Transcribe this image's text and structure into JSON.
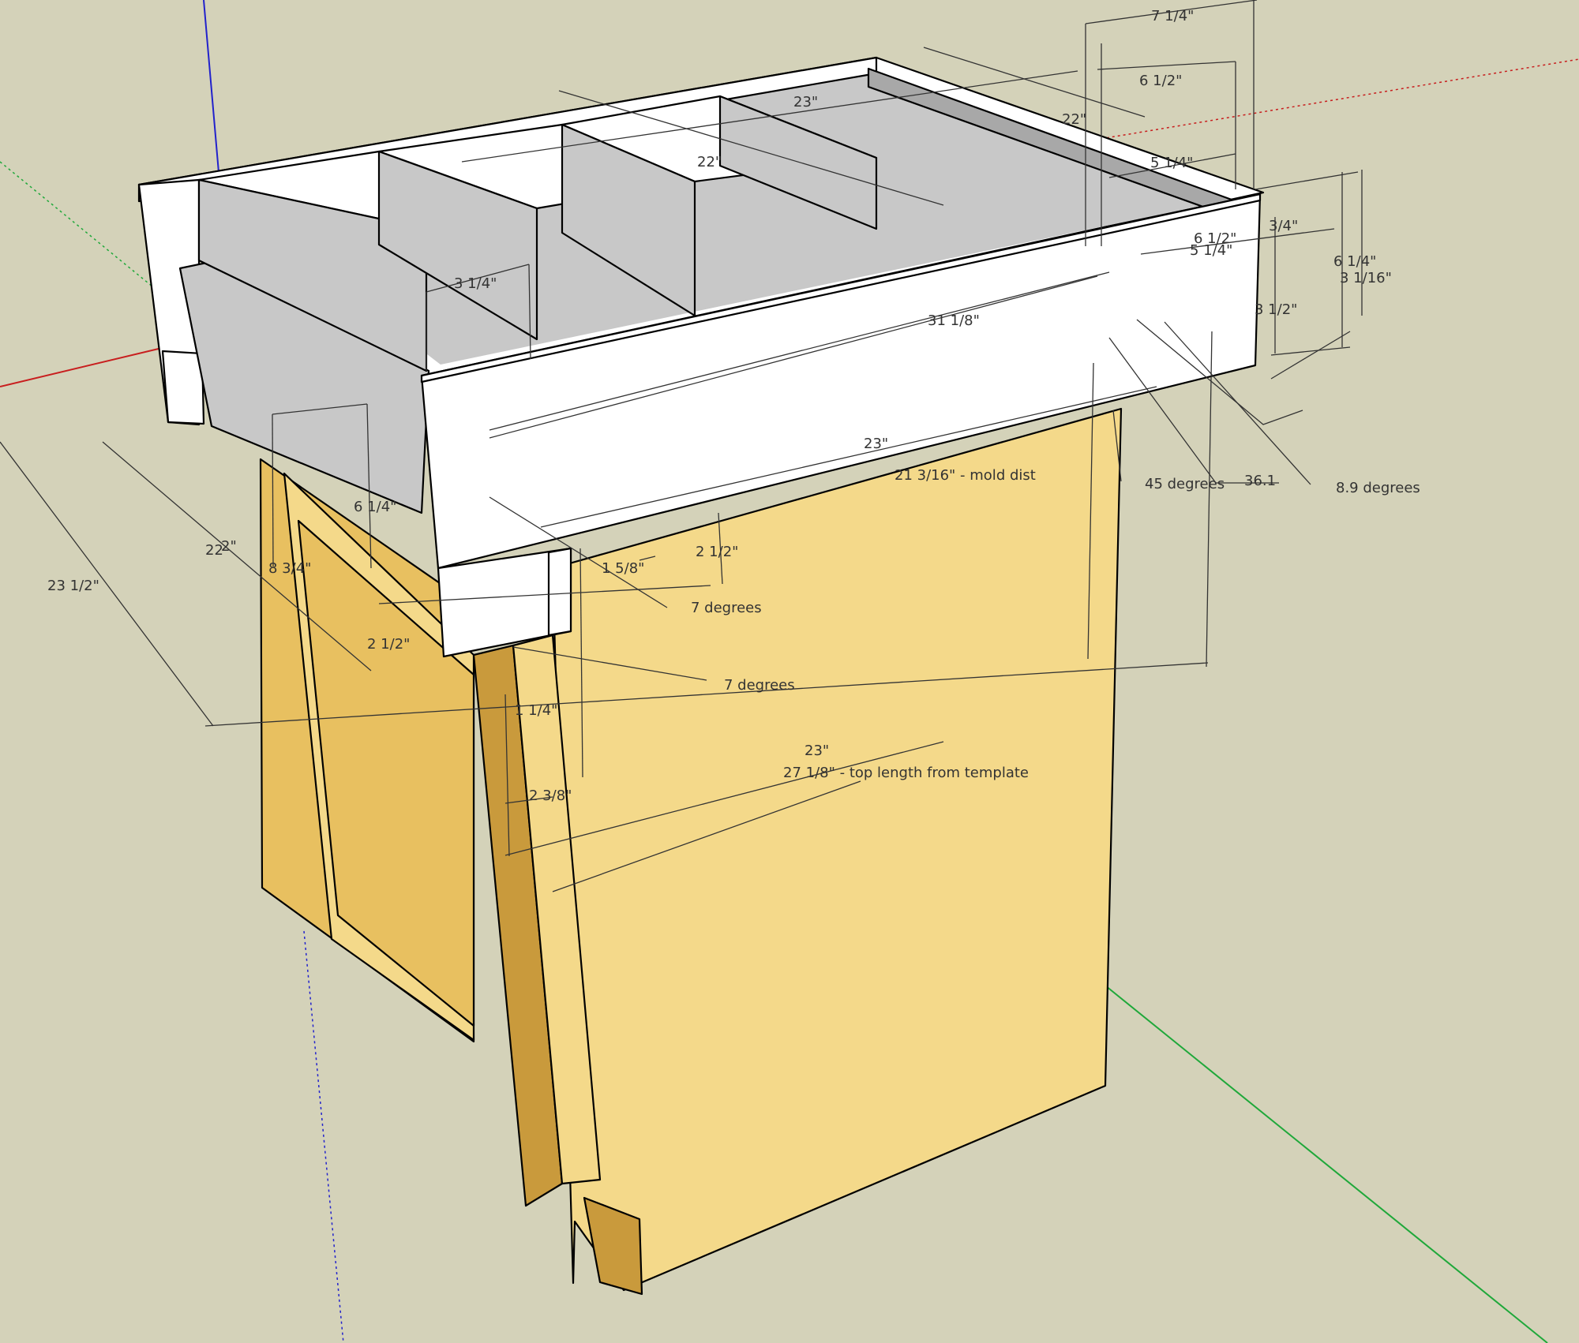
{
  "viewport": {
    "background": "#d4d2b9"
  },
  "colors": {
    "axis_red": "#c81e1e",
    "axis_green": "#1fa83a",
    "axis_blue": "#2222cc",
    "wood_light": "#f4d98a",
    "wood_mid": "#e8c060",
    "wood_dark": "#c99a3c",
    "panel_white": "#ffffff",
    "panel_gray": "#c8c8c8",
    "panel_dark": "#a8a8a8"
  },
  "dimensions": [
    "7 1/4\"",
    "6 1/2\"",
    "23\"",
    "22\"",
    "22\"",
    "5 1/4\"",
    "3/4\"",
    "6 1/2\"",
    "5 1/4\"",
    "6 1/4\"",
    "3 1/16\"",
    "3 1/2\"",
    "31 1/8\"",
    "3 1/4\"",
    "23\"",
    "21 3/16\" - mold dist",
    "45 degrees",
    "36.1",
    "8.9 degrees",
    "6 1/4\"",
    "22",
    "2\"",
    "8 3/4\"",
    "23 1/2\"",
    "2 1/2\"",
    "1 5/8\"",
    "7 degrees",
    "2 1/2\"",
    "7 degrees",
    "1 1/4\"",
    "23\"",
    "27 1/8\" - top length from template",
    "2 3/8\""
  ]
}
